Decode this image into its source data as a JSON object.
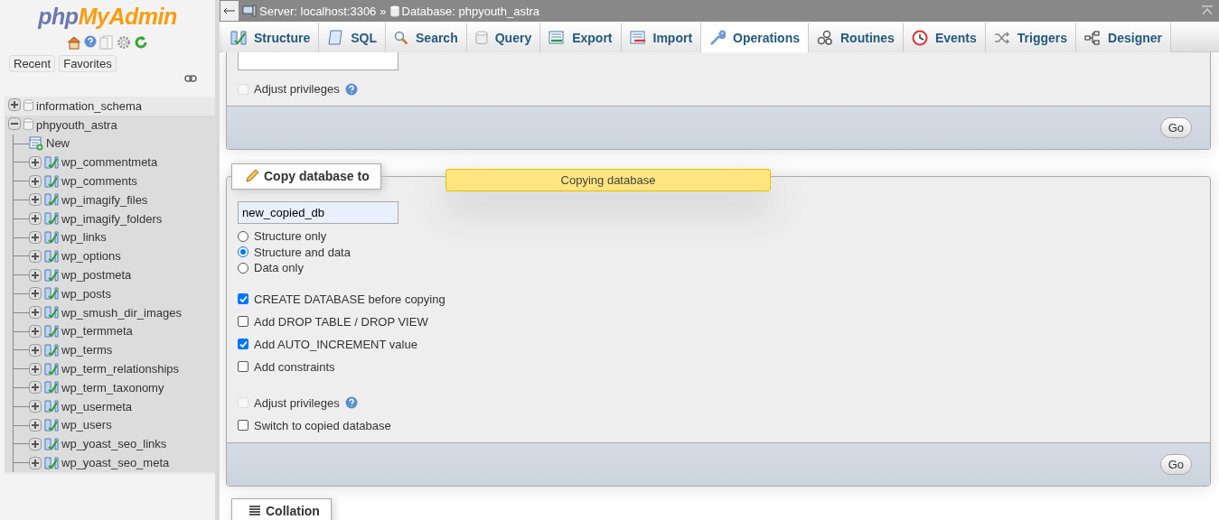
{
  "logo": {
    "prefix": "php",
    "name": "MyAdmin"
  },
  "sidebar": {
    "buttons": [
      "Recent",
      "Favorites"
    ],
    "tree": [
      {
        "label": "information_schema",
        "expanded": false,
        "selected": false
      },
      {
        "label": "phpyouth_astra",
        "expanded": true,
        "selected": true,
        "children": [
          {
            "kind": "new",
            "label": "New"
          },
          {
            "kind": "table",
            "label": "wp_commentmeta"
          },
          {
            "kind": "table",
            "label": "wp_comments"
          },
          {
            "kind": "table",
            "label": "wp_imagify_files"
          },
          {
            "kind": "table",
            "label": "wp_imagify_folders"
          },
          {
            "kind": "table",
            "label": "wp_links"
          },
          {
            "kind": "table",
            "label": "wp_options"
          },
          {
            "kind": "table",
            "label": "wp_postmeta"
          },
          {
            "kind": "table",
            "label": "wp_posts"
          },
          {
            "kind": "table",
            "label": "wp_smush_dir_images"
          },
          {
            "kind": "table",
            "label": "wp_termmeta"
          },
          {
            "kind": "table",
            "label": "wp_terms"
          },
          {
            "kind": "table",
            "label": "wp_term_relationships"
          },
          {
            "kind": "table",
            "label": "wp_term_taxonomy"
          },
          {
            "kind": "table",
            "label": "wp_usermeta"
          },
          {
            "kind": "table",
            "label": "wp_users"
          },
          {
            "kind": "table",
            "label": "wp_yoast_seo_links"
          },
          {
            "kind": "table",
            "label": "wp_yoast_seo_meta"
          }
        ]
      }
    ]
  },
  "breadcrumb": {
    "server": "Server: localhost:3306",
    "separator": "»",
    "database": "Database: phpyouth_astra"
  },
  "tabs": [
    {
      "label": "Structure",
      "selected": false
    },
    {
      "label": "SQL",
      "selected": false
    },
    {
      "label": "Search",
      "selected": false
    },
    {
      "label": "Query",
      "selected": false
    },
    {
      "label": "Export",
      "selected": false
    },
    {
      "label": "Import",
      "selected": false
    },
    {
      "label": "Operations",
      "selected": true
    },
    {
      "label": "Routines",
      "selected": false
    },
    {
      "label": "Events",
      "selected": false
    },
    {
      "label": "Triggers",
      "selected": false
    },
    {
      "label": "Designer",
      "selected": false
    }
  ],
  "previous_section": {
    "options": [
      {
        "label": "Adjust privileges",
        "checked": false,
        "disabled": true,
        "help": true
      }
    ],
    "go": "Go"
  },
  "copy_section": {
    "legend": "Copy database to",
    "name_value": "new_copied_db",
    "notification": "Copying database",
    "modes": [
      {
        "label": "Structure only",
        "selected": false
      },
      {
        "label": "Structure and data",
        "selected": true
      },
      {
        "label": "Data only",
        "selected": false
      }
    ],
    "options": [
      {
        "label": "CREATE DATABASE before copying",
        "checked": true,
        "disabled": false,
        "help": false
      },
      {
        "label": "Add DROP TABLE / DROP VIEW",
        "checked": false,
        "disabled": false,
        "help": false
      },
      {
        "label": "Add AUTO_INCREMENT value",
        "checked": true,
        "disabled": false,
        "help": false
      },
      {
        "label": "Add constraints",
        "checked": false,
        "disabled": false,
        "help": false
      }
    ],
    "extra_options": [
      {
        "label": "Adjust privileges",
        "checked": false,
        "disabled": true,
        "help": true
      },
      {
        "label": "Switch to copied database",
        "checked": false,
        "disabled": false,
        "help": false
      }
    ],
    "go": "Go"
  },
  "collation_section": {
    "legend": "Collation"
  }
}
